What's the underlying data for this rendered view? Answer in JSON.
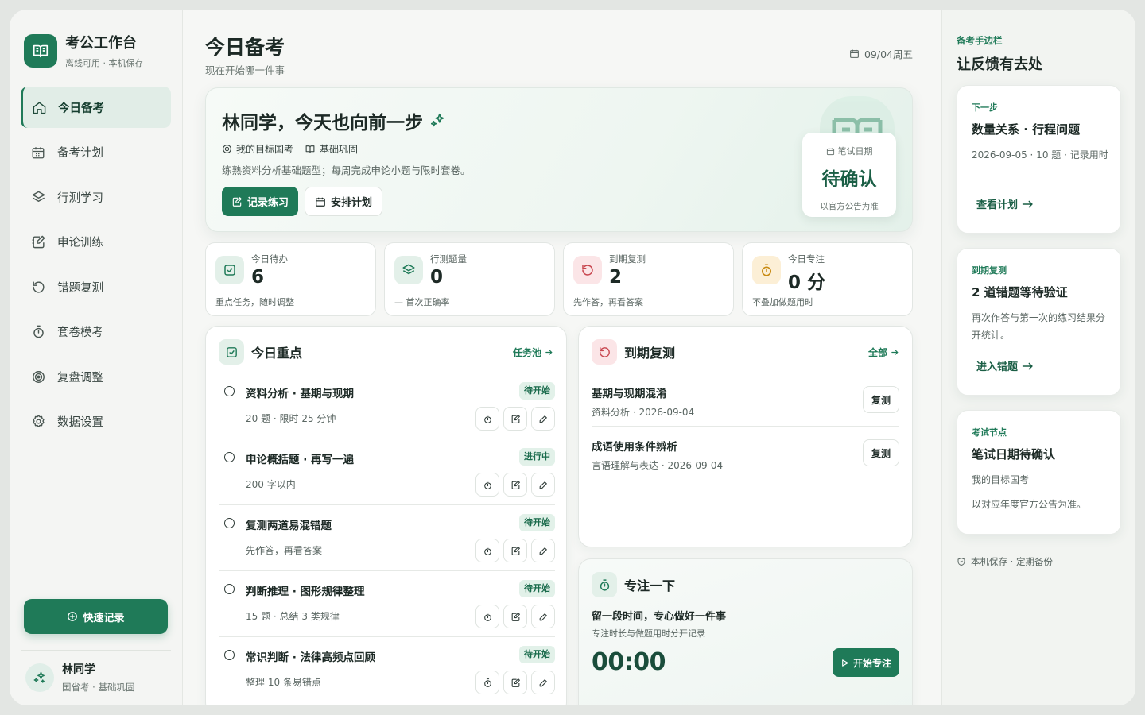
{
  "colors": {
    "accent": "#1f7a58",
    "accent_dark": "#1a5e45",
    "accent_soft": "#e1ede7"
  },
  "brand": {
    "title": "考公工作台",
    "subtitle": "离线可用 · 本机保存",
    "icon": "book-open-icon"
  },
  "nav": [
    {
      "label": "今日备考",
      "icon": "home-icon",
      "active": true
    },
    {
      "label": "备考计划",
      "icon": "calendar-icon"
    },
    {
      "label": "行测学习",
      "icon": "layers-icon"
    },
    {
      "label": "申论训练",
      "icon": "edit-note-icon"
    },
    {
      "label": "错题复测",
      "icon": "rotate-icon"
    },
    {
      "label": "套卷模考",
      "icon": "timer-icon"
    },
    {
      "label": "复盘调整",
      "icon": "target-icon"
    },
    {
      "label": "数据设置",
      "icon": "gear-icon"
    }
  ],
  "quick": {
    "label": "快速记录",
    "icon": "plus-circle-icon"
  },
  "user": {
    "name": "林同学",
    "sub": "国省考 · 基础巩固",
    "icon": "sparkle-icon"
  },
  "header": {
    "title": "今日备考",
    "subtitle": "现在开始哪一件事",
    "date": "09/04周五"
  },
  "hero": {
    "title": "林同学，今天也向前一步",
    "tag1": "我的目标国考",
    "tag2": "基础巩固",
    "desc": "练熟资料分析基础题型；每周完成申论小题与限时套卷。",
    "btn_record": "记录练习",
    "btn_plan": "安排计划",
    "card_label": "笔试日期",
    "card_value": "待确认",
    "card_note": "以官方公告为准"
  },
  "stats": [
    {
      "label": "今日待办",
      "value": "6",
      "note": "重点任务，随时调整",
      "icon": "check-square-icon"
    },
    {
      "label": "行测题量",
      "value": "0",
      "note": "— 首次正确率",
      "icon": "layers-icon"
    },
    {
      "label": "到期复测",
      "value": "2",
      "note": "先作答，再看答案",
      "icon": "rotate-icon"
    },
    {
      "label": "今日专注",
      "value": "0 分",
      "note": "不叠加做题用时",
      "icon": "timer-icon"
    }
  ],
  "focus_panel": {
    "title": "今日重点",
    "link": "任务池"
  },
  "tasks": [
    {
      "title": "资料分析 · 基期与现期",
      "status": "待开始",
      "meta": "20 题 · 限时 25 分钟"
    },
    {
      "title": "申论概括题 · 再写一遍",
      "status": "进行中",
      "meta": "200 字以内"
    },
    {
      "title": "复测两道易混错题",
      "status": "待开始",
      "meta": "先作答，再看答案"
    },
    {
      "title": "判断推理 · 图形规律整理",
      "status": "待开始",
      "meta": "15 题 · 总结 3 类规律"
    },
    {
      "title": "常识判断 · 法律高频点回顾",
      "status": "待开始",
      "meta": "整理 10 条易错点"
    }
  ],
  "review_panel": {
    "title": "到期复测",
    "link": "全部",
    "btn": "复测"
  },
  "reviews": [
    {
      "title": "基期与现期混淆",
      "meta": "资料分析 · 2026-09-04"
    },
    {
      "title": "成语使用条件辨析",
      "meta": "言语理解与表达 · 2026-09-04"
    }
  ],
  "timer_panel": {
    "title": "专注一下",
    "main": "留一段时间，专心做好一件事",
    "sub": "专注时长与做题用时分开记录",
    "time": "00:00",
    "btn": "开始专注"
  },
  "rail": {
    "eyebrow": "备考手边栏",
    "title": "让反馈有去处",
    "cards": [
      {
        "eyebrow": "下一步",
        "title": "数量关系 · 行程问题",
        "desc": "2026-09-05 · 10 题 · 记录用时",
        "link": "查看计划"
      },
      {
        "eyebrow": "到期复测",
        "title": "2 道错题等待验证",
        "desc": "再次作答与第一次的练习结果分开统计。",
        "link": "进入错题"
      },
      {
        "eyebrow": "考试节点",
        "title": "笔试日期待确认",
        "desc": "我的目标国考",
        "desc2": "以对应年度官方公告为准。"
      }
    ],
    "foot": "本机保存 · 定期备份"
  }
}
